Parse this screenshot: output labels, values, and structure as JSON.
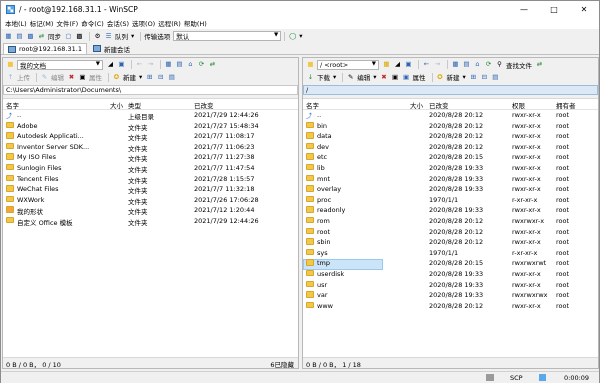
{
  "window": {
    "title": "/ - root@192.168.31.1 - WinSCP"
  },
  "menu": [
    "本地(L)",
    "标记(M)",
    "文件(F)",
    "命令(C)",
    "会话(S)",
    "选项(O)",
    "远程(R)",
    "帮助(H)"
  ],
  "toolbar": {
    "sync_label": "同步",
    "queue_label": "队列",
    "transfer_label": "传输选项",
    "transfer_value": "默认"
  },
  "tabs": {
    "session": "root@192.168.31.1",
    "new_session": "新建会话"
  },
  "local": {
    "drive": "我的文档",
    "path": "C:\\Users\\Administrator\\Documents\\",
    "upload_label": "上传",
    "edit_label": "编辑",
    "props_label": "属性",
    "new_label": "新建",
    "columns": {
      "name": "名字",
      "size": "大小",
      "type": "类型",
      "changed": "已改变"
    },
    "rows": [
      {
        "name": "..",
        "type": "上级目录",
        "changed": "2021/7/29 12:44:26",
        "icon": "up"
      },
      {
        "name": "Adobe",
        "type": "文件夹",
        "changed": "2021/7/27 15:48:34",
        "icon": "folder"
      },
      {
        "name": "Autodesk Applicati...",
        "type": "文件夹",
        "changed": "2021/7/7 11:08:17",
        "icon": "folder"
      },
      {
        "name": "Inventor Server SDK...",
        "type": "文件夹",
        "changed": "2021/7/7 11:06:23",
        "icon": "folder"
      },
      {
        "name": "My ISO Files",
        "type": "文件夹",
        "changed": "2021/7/7 11:27:38",
        "icon": "folder"
      },
      {
        "name": "Sunlogin Files",
        "type": "文件夹",
        "changed": "2021/7/7 11:47:54",
        "icon": "folder"
      },
      {
        "name": "Tencent Files",
        "type": "文件夹",
        "changed": "2021/7/28 1:15:57",
        "icon": "folder"
      },
      {
        "name": "WeChat Files",
        "type": "文件夹",
        "changed": "2021/7/7 11:32:18",
        "icon": "folder"
      },
      {
        "name": "WXWork",
        "type": "文件夹",
        "changed": "2021/7/26 17:06:28",
        "icon": "folder"
      },
      {
        "name": "我的形状",
        "type": "文件夹",
        "changed": "2021/7/12 1:20:44",
        "icon": "special"
      },
      {
        "name": "自定义 Office 模板",
        "type": "文件夹",
        "changed": "2021/7/29 12:44:26",
        "icon": "folder"
      }
    ],
    "status_left": "0 B / 0 B， 0 / 10",
    "status_right": "6已隐藏"
  },
  "remote": {
    "drive": "/ <root>",
    "path": "/",
    "find_label": "查找文件",
    "download_label": "下载",
    "edit_label": "编辑",
    "props_label": "属性",
    "new_label": "新建",
    "columns": {
      "name": "名字",
      "size": "大小",
      "changed": "已改变",
      "rights": "权限",
      "owner": "拥有者"
    },
    "rows": [
      {
        "name": "..",
        "changed": "2020/8/28 20:12",
        "rights": "rwxr-xr-x",
        "owner": "root",
        "icon": "up"
      },
      {
        "name": "bin",
        "changed": "2020/8/28 20:12",
        "rights": "rwxr-xr-x",
        "owner": "root",
        "icon": "folder"
      },
      {
        "name": "data",
        "changed": "2020/8/28 20:12",
        "rights": "rwxr-xr-x",
        "owner": "root",
        "icon": "folder"
      },
      {
        "name": "dev",
        "changed": "2020/8/28 20:12",
        "rights": "rwxr-xr-x",
        "owner": "root",
        "icon": "folder"
      },
      {
        "name": "etc",
        "changed": "2020/8/28 20:15",
        "rights": "rwxr-xr-x",
        "owner": "root",
        "icon": "folder"
      },
      {
        "name": "lib",
        "changed": "2020/8/28 19:33",
        "rights": "rwxr-xr-x",
        "owner": "root",
        "icon": "folder"
      },
      {
        "name": "mnt",
        "changed": "2020/8/28 19:33",
        "rights": "rwxr-xr-x",
        "owner": "root",
        "icon": "folder"
      },
      {
        "name": "overlay",
        "changed": "2020/8/28 19:33",
        "rights": "rwxr-xr-x",
        "owner": "root",
        "icon": "folder"
      },
      {
        "name": "proc",
        "changed": "1970/1/1",
        "rights": "r-xr-xr-x",
        "owner": "root",
        "icon": "folder"
      },
      {
        "name": "readonly",
        "changed": "2020/8/28 19:33",
        "rights": "rwxr-xr-x",
        "owner": "root",
        "icon": "folder"
      },
      {
        "name": "rom",
        "changed": "2020/8/28 20:12",
        "rights": "rwxrwxr-x",
        "owner": "root",
        "icon": "folder"
      },
      {
        "name": "root",
        "changed": "2020/8/28 20:12",
        "rights": "rwxr-xr-x",
        "owner": "root",
        "icon": "folder"
      },
      {
        "name": "sbin",
        "changed": "2020/8/28 20:12",
        "rights": "rwxr-xr-x",
        "owner": "root",
        "icon": "folder"
      },
      {
        "name": "sys",
        "changed": "1970/1/1",
        "rights": "r-xr-xr-x",
        "owner": "root",
        "icon": "folder"
      },
      {
        "name": "tmp",
        "changed": "2020/8/28 20:15",
        "rights": "rwxrwxrwt",
        "owner": "root",
        "icon": "folder",
        "selected": true
      },
      {
        "name": "userdisk",
        "changed": "2020/8/28 19:33",
        "rights": "rwxr-xr-x",
        "owner": "root",
        "icon": "folder"
      },
      {
        "name": "usr",
        "changed": "2020/8/28 19:33",
        "rights": "rwxr-xr-x",
        "owner": "root",
        "icon": "folder"
      },
      {
        "name": "var",
        "changed": "2020/8/28 19:33",
        "rights": "rwxrwxrwx",
        "owner": "root",
        "icon": "link"
      },
      {
        "name": "www",
        "changed": "2020/8/28 20:12",
        "rights": "rwxr-xr-x",
        "owner": "root",
        "icon": "folder"
      }
    ],
    "status_left": "0 B / 0 B， 1 / 18"
  },
  "bottom": {
    "protocol": "SCP",
    "time": "0:00:09"
  }
}
